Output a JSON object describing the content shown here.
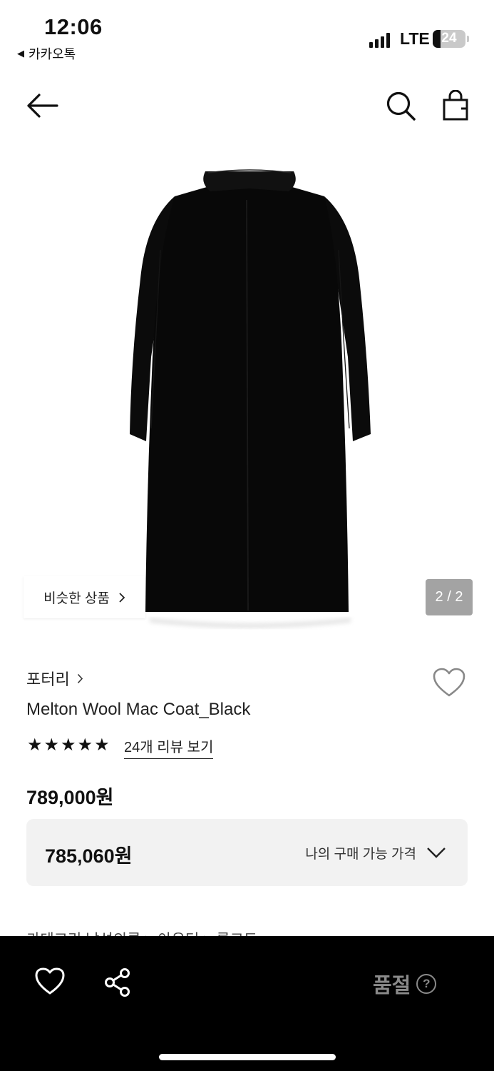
{
  "status_bar": {
    "time": "12:06",
    "back_app": "카카오톡",
    "network": "LTE",
    "battery": "24",
    "battery_level_percent": 24
  },
  "nav": {
    "back_icon": "arrow-left-icon",
    "search_icon": "search-icon",
    "bag_icon": "shopping-bag-icon"
  },
  "image": {
    "similar_products_label": "비슷한 상품",
    "pager": "2 / 2"
  },
  "product": {
    "brand": "포터리",
    "name": "Melton Wool Mac Coat_Black",
    "rating_stars": 5,
    "review_link": "24개 리뷰 보기",
    "price": "789,000원"
  },
  "my_price": {
    "value": "785,060원",
    "label": "나의 구매 가능 가격"
  },
  "category_peek": "카테고리 남성의류 > 아우터 > 롱코트",
  "bottom_bar": {
    "sold_out": "품절",
    "help_glyph": "?"
  },
  "colors": {
    "accent": "#111111",
    "price_box_bg": "#f2f2f2",
    "bottom_bar_bg": "#000000",
    "sold_out_text": "#8a8a8a"
  }
}
